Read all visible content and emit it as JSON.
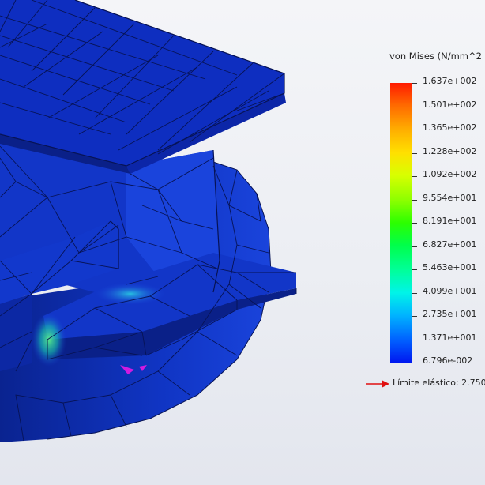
{
  "legend": {
    "title": "von Mises (N/mm^2",
    "ticks": [
      "1.637e+002",
      "1.501e+002",
      "1.365e+002",
      "1.228e+002",
      "1.092e+002",
      "9.554e+001",
      "8.191e+001",
      "6.827e+001",
      "5.463e+001",
      "4.099e+001",
      "2.735e+001",
      "1.371e+001",
      "6.796e-002"
    ],
    "yield_label": "Límite elástico: 2.750"
  },
  "colors": {
    "mesh_dark": "#0a1a6e",
    "mesh_mid": "#0d2fbe",
    "mesh_light": "#1e46e6",
    "hot_green": "#39e07a",
    "yield_arrow": "#e01010",
    "hotspot_magenta": "#d21ae0"
  }
}
